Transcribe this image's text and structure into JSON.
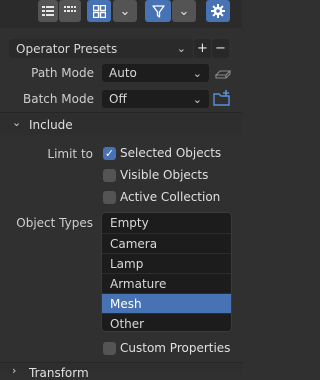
{
  "toolbar": {
    "icons": [
      "list-view-icon",
      "thumbnail-view-icon",
      "filter-icon",
      "gear-icon"
    ]
  },
  "presets": {
    "label": "Operator Presets"
  },
  "path_mode": {
    "label": "Path Mode",
    "value": "Auto"
  },
  "batch_mode": {
    "label": "Batch Mode",
    "value": "Off"
  },
  "include": {
    "title": "Include",
    "limit_to_label": "Limit to",
    "selected_objects": {
      "label": "Selected Objects",
      "checked": true
    },
    "visible_objects": {
      "label": "Visible Objects",
      "checked": false
    },
    "active_collection": {
      "label": "Active Collection",
      "checked": false
    },
    "object_types_label": "Object Types",
    "object_types": [
      "Empty",
      "Camera",
      "Lamp",
      "Armature",
      "Mesh",
      "Other"
    ],
    "selected_type": "Mesh",
    "custom_properties": {
      "label": "Custom Properties",
      "checked": false
    }
  },
  "transform": {
    "title": "Transform"
  },
  "colors": {
    "accent": "#4772b3",
    "panel": "#303030",
    "field": "#1d1d1d"
  }
}
